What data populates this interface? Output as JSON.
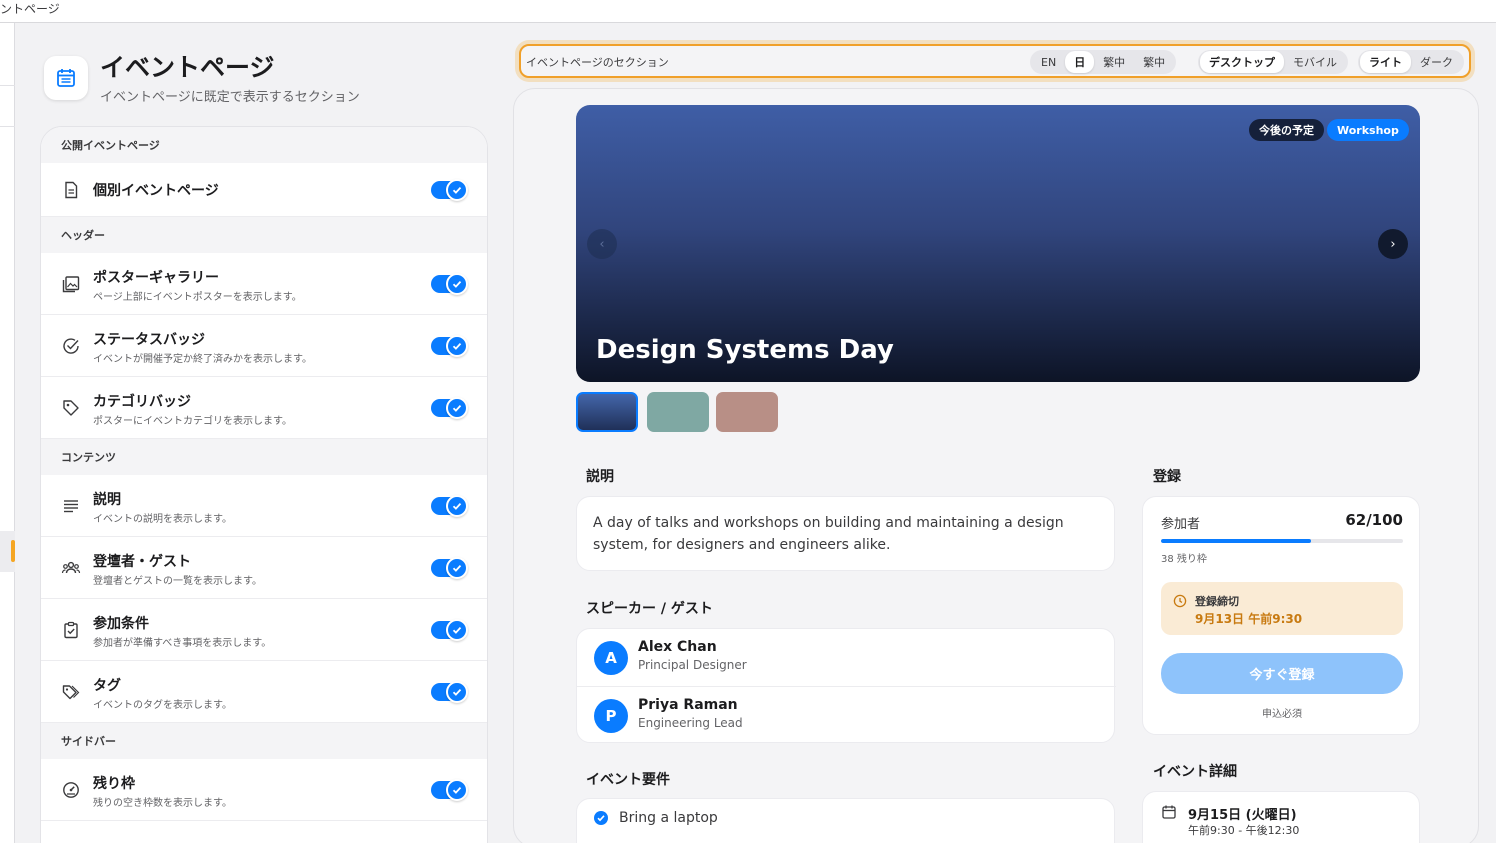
{
  "window": {
    "title": "ベントページ"
  },
  "header": {
    "title": "イベントページ",
    "subtitle": "イベントページに既定で表示するセクション",
    "icon": "calendar-icon"
  },
  "settings": {
    "sections": [
      {
        "heading": "公開イベントページ",
        "items": [
          {
            "title": "個別イベントページ",
            "description": "",
            "icon": "document-icon",
            "enabled": true
          }
        ]
      },
      {
        "heading": "ヘッダー",
        "items": [
          {
            "title": "ポスターギャラリー",
            "description": "ページ上部にイベントポスターを表示します。",
            "icon": "gallery-icon",
            "enabled": true
          },
          {
            "title": "ステータスバッジ",
            "description": "イベントが開催予定か終了済みかを表示します。",
            "icon": "check-circle-icon",
            "enabled": true
          },
          {
            "title": "カテゴリバッジ",
            "description": "ポスターにイベントカテゴリを表示します。",
            "icon": "tag-icon",
            "enabled": true
          }
        ]
      },
      {
        "heading": "コンテンツ",
        "items": [
          {
            "title": "説明",
            "description": "イベントの説明を表示します。",
            "icon": "lines-icon",
            "enabled": true
          },
          {
            "title": "登壇者・ゲスト",
            "description": "登壇者とゲストの一覧を表示します。",
            "icon": "people-icon",
            "enabled": true
          },
          {
            "title": "参加条件",
            "description": "参加者が準備すべき事項を表示します。",
            "icon": "clipboard-check-icon",
            "enabled": true
          },
          {
            "title": "タグ",
            "description": "イベントのタグを表示します。",
            "icon": "tags-icon",
            "enabled": true
          }
        ]
      },
      {
        "heading": "サイドバー",
        "items": [
          {
            "title": "残り枠",
            "description": "残りの空き枠数を表示します。",
            "icon": "gauge-icon",
            "enabled": true
          }
        ]
      }
    ]
  },
  "toolbar": {
    "label": "イベントページのセクション",
    "languages": [
      "EN",
      "日",
      "繁中",
      "繁中"
    ],
    "language_selected": "日",
    "devices": [
      "デスクトップ",
      "モバイル"
    ],
    "device_selected": "デスクトップ",
    "themes": [
      "ライト",
      "ダーク"
    ],
    "theme_selected": "ライト"
  },
  "preview": {
    "hero": {
      "title": "Design Systems Day",
      "status_badge": "今後の予定",
      "category_badge": "Workshop",
      "prev_icon": "chevron-left-icon",
      "next_icon": "chevron-right-icon"
    },
    "thumbnails": [
      {
        "color": "#2f4680",
        "selected": true
      },
      {
        "color": "#7fa8a3",
        "selected": false
      },
      {
        "color": "#b88f86",
        "selected": false
      }
    ],
    "description": {
      "heading": "説明",
      "text": "A day of talks and workshops on building and maintaining a design system, for designers and engineers alike."
    },
    "speakers": {
      "heading": "スピーカー / ゲスト",
      "list": [
        {
          "initial": "A",
          "name": "Alex Chan",
          "role": "Principal Designer"
        },
        {
          "initial": "P",
          "name": "Priya Raman",
          "role": "Engineering Lead"
        }
      ]
    },
    "requirements": {
      "heading": "イベント要件",
      "list": [
        "Bring a laptop"
      ]
    },
    "registration": {
      "heading": "登録",
      "attendees_label": "参加者",
      "count": "62/100",
      "progress": 0.62,
      "remaining": "38 残り枠",
      "deadline_label": "登録締切",
      "deadline_value": "9月13日 午前9:30",
      "button": "今すぐ登録",
      "note": "申込必須"
    },
    "details": {
      "heading": "イベント詳細",
      "date": "9月15日 (火曜日)",
      "time": "午前9:30 - 午後12:30"
    }
  },
  "colors": {
    "accent": "#0a7cff",
    "highlight": "#f0a02a",
    "deadline_bg": "#faebd5",
    "deadline_text": "#c87a10"
  }
}
